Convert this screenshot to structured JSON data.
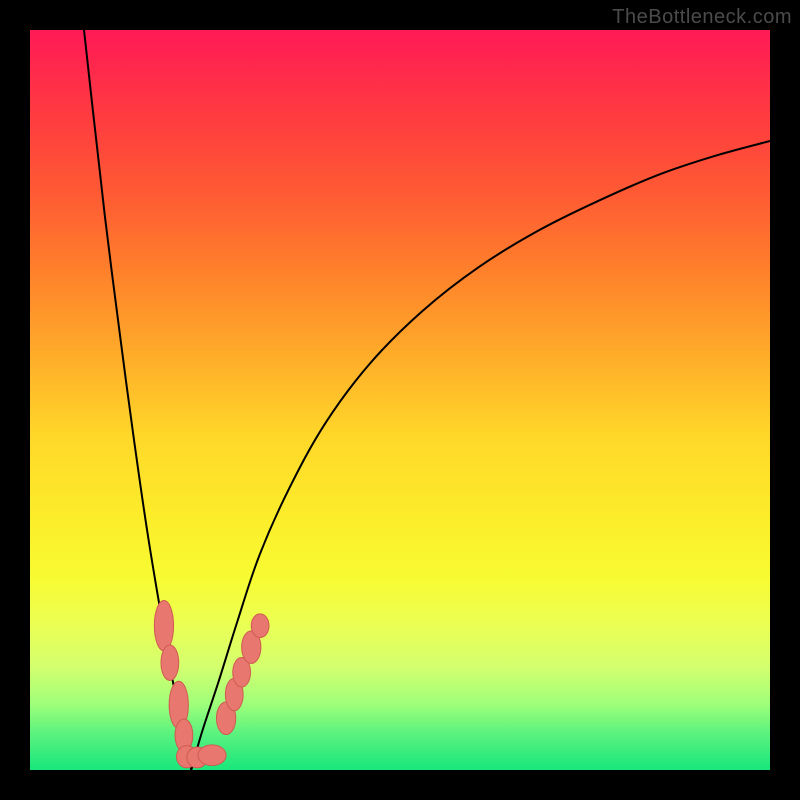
{
  "attribution": "TheBottleneck.com",
  "chart_data": {
    "type": "line",
    "title": "",
    "xlabel": "",
    "ylabel": "",
    "x_range": [
      0,
      100
    ],
    "y_range": [
      0,
      100
    ],
    "colors": {
      "curve": "#000000",
      "marker_fill": "#e8786f",
      "marker_stroke": "#cf5a52"
    },
    "gradient_stops": [
      {
        "pct": 0,
        "color": "#ff1a56"
      },
      {
        "pct": 12,
        "color": "#ff3c3f"
      },
      {
        "pct": 22,
        "color": "#ff5a34"
      },
      {
        "pct": 32,
        "color": "#ff7e2b"
      },
      {
        "pct": 45,
        "color": "#ffb029"
      },
      {
        "pct": 55,
        "color": "#ffd829"
      },
      {
        "pct": 66,
        "color": "#fced2a"
      },
      {
        "pct": 74,
        "color": "#f7fb32"
      },
      {
        "pct": 80,
        "color": "#ecff52"
      },
      {
        "pct": 86,
        "color": "#d4ff6e"
      },
      {
        "pct": 91,
        "color": "#a0ff7a"
      },
      {
        "pct": 95,
        "color": "#5cf27e"
      },
      {
        "pct": 100,
        "color": "#18e77c"
      }
    ],
    "series": [
      {
        "name": "left-branch",
        "x": [
          7.3,
          8.4,
          10.1,
          12.0,
          14.0,
          16.2,
          19.3,
          20.5,
          21.4,
          21.8
        ],
        "y": [
          100,
          90,
          75,
          60,
          45,
          30,
          12,
          6,
          2,
          0
        ]
      },
      {
        "name": "right-branch",
        "x": [
          21.8,
          23.2,
          25.5,
          28.0,
          31.0,
          35.0,
          40.0,
          46.0,
          53.0,
          60.7,
          68.9,
          77.0,
          85.1,
          92.6,
          100.0
        ],
        "y": [
          0,
          5,
          12,
          20,
          29,
          38,
          47,
          55,
          62,
          68,
          73,
          77,
          80.5,
          83,
          85
        ]
      }
    ],
    "markers": [
      {
        "x": 18.1,
        "y": 19.5,
        "rx": 1.3,
        "ry": 3.4
      },
      {
        "x": 18.9,
        "y": 14.5,
        "rx": 1.2,
        "ry": 2.4
      },
      {
        "x": 20.1,
        "y": 8.8,
        "rx": 1.3,
        "ry": 3.2
      },
      {
        "x": 20.8,
        "y": 4.7,
        "rx": 1.2,
        "ry": 2.2
      },
      {
        "x": 21.2,
        "y": 1.8,
        "rx": 1.4,
        "ry": 1.5
      },
      {
        "x": 22.6,
        "y": 1.7,
        "rx": 1.4,
        "ry": 1.4
      },
      {
        "x": 24.6,
        "y": 2.0,
        "rx": 1.9,
        "ry": 1.4
      },
      {
        "x": 26.5,
        "y": 7.0,
        "rx": 1.3,
        "ry": 2.2
      },
      {
        "x": 27.6,
        "y": 10.2,
        "rx": 1.2,
        "ry": 2.2
      },
      {
        "x": 28.6,
        "y": 13.2,
        "rx": 1.2,
        "ry": 2.0
      },
      {
        "x": 29.9,
        "y": 16.6,
        "rx": 1.3,
        "ry": 2.2
      },
      {
        "x": 31.1,
        "y": 19.5,
        "rx": 1.2,
        "ry": 1.6
      }
    ],
    "notes": "y values are percent of plot height measured from bottom (0 = bottom green, 100 = top red). x values are percent of plot width from left. Curve is a V-shaped bottleneck curve; minimum at x≈21.8. Pink lozenge markers cluster along both branches near the valley between y≈2 and y≈20."
  }
}
